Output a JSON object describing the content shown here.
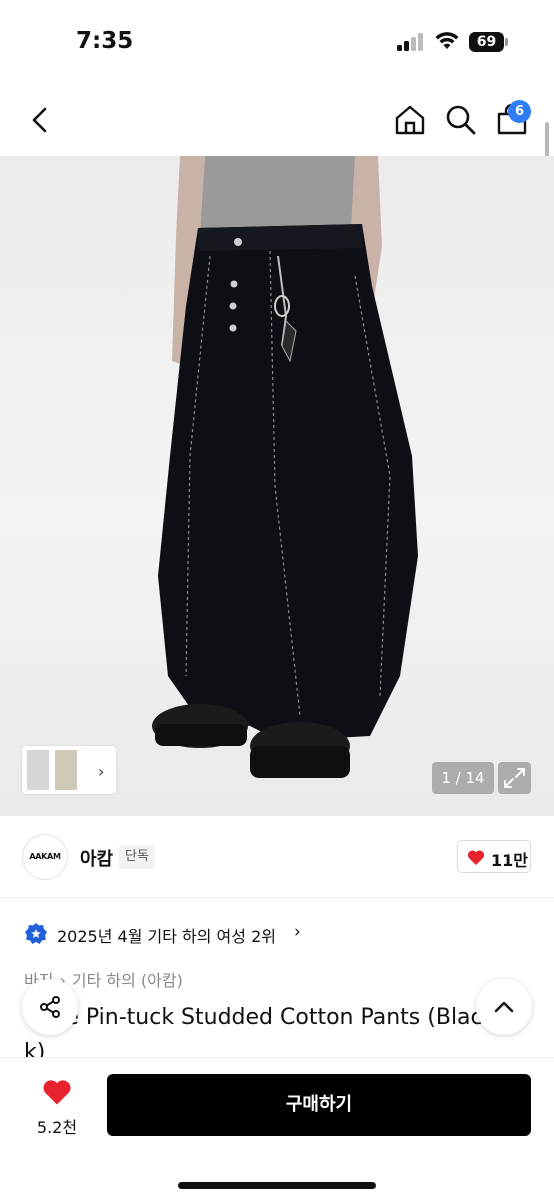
{
  "status": {
    "time": "7:35",
    "battery": "69"
  },
  "nav": {
    "back_icon": "chevron-left-icon",
    "home_icon": "home-icon",
    "search_icon": "search-icon",
    "cart_icon": "shopping-bag-icon",
    "cart_count": "6"
  },
  "gallery": {
    "counter": "1 / 14",
    "expand_icon": "expand-icon",
    "thumb_chevron": "›"
  },
  "brand": {
    "logo_text": "AAKAM",
    "name": "아캄",
    "tag": "단독",
    "likes": "11만"
  },
  "ranking": {
    "text": "2025년 4월 기타 하의 여성 2위",
    "chevron": "›"
  },
  "breadcrumb": {
    "items": [
      "바지",
      "기타 하의 (아캄)"
    ],
    "separator": "›"
  },
  "product": {
    "title_line1": "Wide Pin-tuck Studded Cotton Pants (Black",
    "title_line2": "k)"
  },
  "bottom": {
    "wish_count": "5.2천",
    "buy_label": "구매하기"
  },
  "colors": {
    "accent_badge": "#2f7df6",
    "heart": "#e8212e",
    "buy_button": "#000000"
  }
}
